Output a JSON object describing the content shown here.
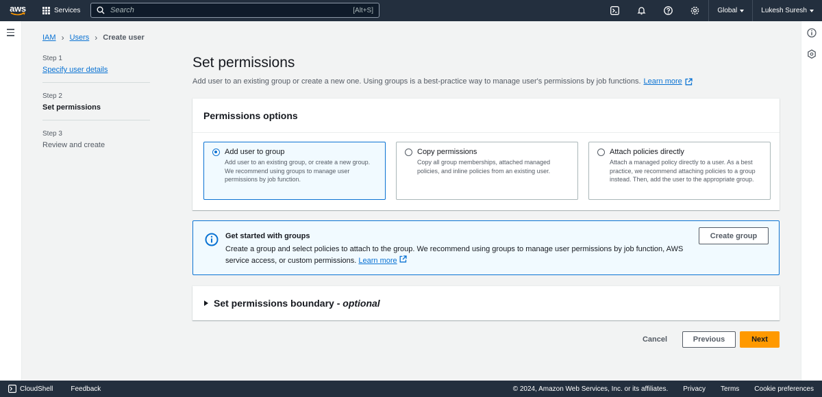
{
  "topnav": {
    "logo_text": "aws",
    "services_label": "Services",
    "search_placeholder": "Search",
    "search_shortcut": "[Alt+S]",
    "region_label": "Global",
    "user_label": "Lukesh Suresh"
  },
  "breadcrumb": {
    "items": [
      "IAM",
      "Users"
    ],
    "current": "Create user"
  },
  "steps": [
    {
      "num": "Step 1",
      "label": "Specify user details",
      "state": "link"
    },
    {
      "num": "Step 2",
      "label": "Set permissions",
      "state": "active"
    },
    {
      "num": "Step 3",
      "label": "Review and create",
      "state": "disabled"
    }
  ],
  "main": {
    "title": "Set permissions",
    "description": "Add user to an existing group or create a new one. Using groups is a best-practice way to manage user's permissions by job functions.",
    "learn_more": "Learn more"
  },
  "permissions_options": {
    "header": "Permissions options",
    "options": [
      {
        "title": "Add user to group",
        "desc": "Add user to an existing group, or create a new group. We recommend using groups to manage user permissions by job function.",
        "selected": true
      },
      {
        "title": "Copy permissions",
        "desc": "Copy all group memberships, attached managed policies, and inline policies from an existing user.",
        "selected": false
      },
      {
        "title": "Attach policies directly",
        "desc": "Attach a managed policy directly to a user. As a best practice, we recommend attaching policies to a group instead. Then, add the user to the appropriate group.",
        "selected": false
      }
    ]
  },
  "info_box": {
    "title": "Get started with groups",
    "text": "Create a group and select policies to attach to the group. We recommend using groups to manage user permissions by job function, AWS service access, or custom permissions.",
    "learn_more": "Learn more",
    "button": "Create group"
  },
  "boundary": {
    "title": "Set permissions boundary - ",
    "optional": "optional"
  },
  "actions": {
    "cancel": "Cancel",
    "previous": "Previous",
    "next": "Next"
  },
  "footer": {
    "cloudshell": "CloudShell",
    "feedback": "Feedback",
    "copyright": "© 2024, Amazon Web Services, Inc. or its affiliates.",
    "privacy": "Privacy",
    "terms": "Terms",
    "cookie": "Cookie preferences"
  },
  "colors": {
    "nav_bg": "#232f3e",
    "link": "#0972d3",
    "primary_button": "#ff9900",
    "info_bg": "#f1faff"
  }
}
